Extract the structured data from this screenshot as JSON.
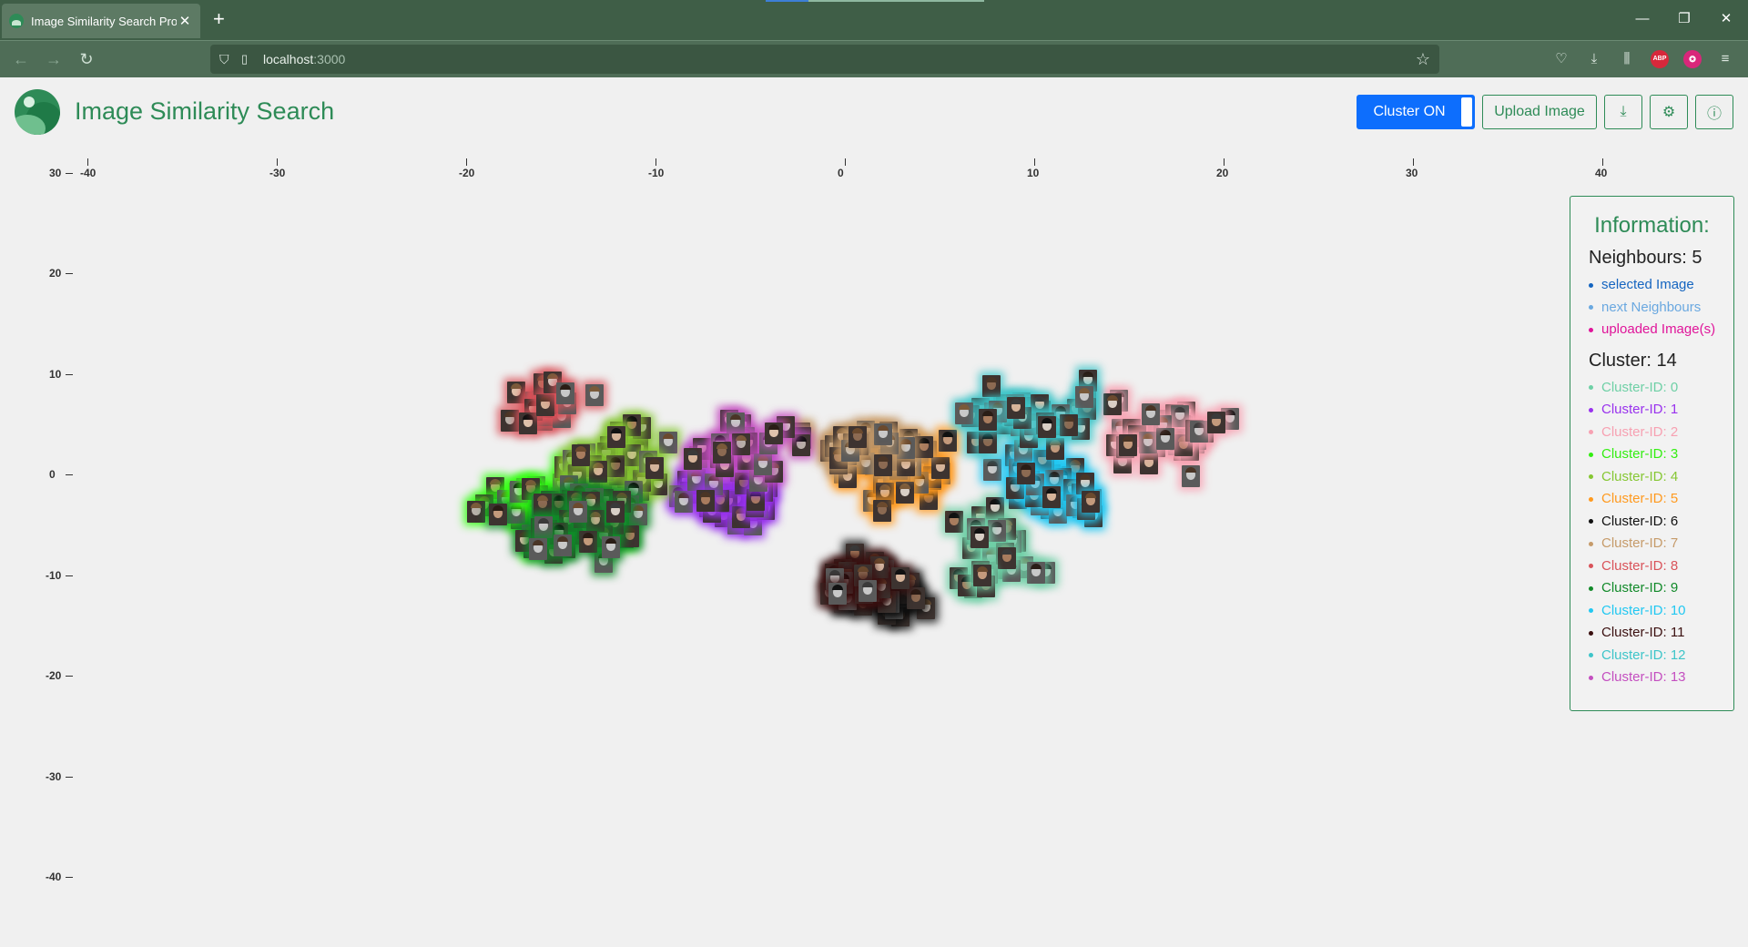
{
  "browser": {
    "tab_title": "Image Similarity Search Project",
    "url_host": "localhost",
    "url_port": ":3000"
  },
  "app": {
    "title": "Image Similarity Search",
    "cluster_toggle_label": "Cluster ON",
    "upload_label": "Upload Image"
  },
  "plot": {
    "x_ticks": [
      "-40",
      "-30",
      "-20",
      "-10",
      "0",
      "10",
      "20",
      "30",
      "40"
    ],
    "y_ticks": [
      "30",
      "20",
      "10",
      "0",
      "-10",
      "-20",
      "-30",
      "-40"
    ],
    "x_range": [
      -40,
      40
    ],
    "y_range": [
      -40,
      30
    ],
    "image_count": 460,
    "cluster_colors": [
      "#6fd0a6",
      "#9932ee",
      "#f7a1b2",
      "#33ff11",
      "#86c733",
      "#ff9a1f",
      "#111111",
      "#c69b6a",
      "#d9535a",
      "#128a2a",
      "#22c8f2",
      "#3b1010",
      "#3ec5c9",
      "#c44fc0"
    ],
    "clusters": [
      {
        "id": 0,
        "cx": 8,
        "cy": -7,
        "sx": 3,
        "sy": 5,
        "n": 30
      },
      {
        "id": 1,
        "cx": -6,
        "cy": -1,
        "sx": 3,
        "sy": 4,
        "n": 40
      },
      {
        "id": 2,
        "cx": 17,
        "cy": 4,
        "sx": 3,
        "sy": 4,
        "n": 40
      },
      {
        "id": 3,
        "cx": -16,
        "cy": -3,
        "sx": 4,
        "sy": 4,
        "n": 35
      },
      {
        "id": 4,
        "cx": -12,
        "cy": 1,
        "sx": 3,
        "sy": 4,
        "n": 40
      },
      {
        "id": 5,
        "cx": 3,
        "cy": 0,
        "sx": 3,
        "sy": 4,
        "n": 40
      },
      {
        "id": 6,
        "cx": 2,
        "cy": -12,
        "sx": 3,
        "sy": 3,
        "n": 30
      },
      {
        "id": 7,
        "cx": 1,
        "cy": 3,
        "sx": 3,
        "sy": 3,
        "n": 25
      },
      {
        "id": 8,
        "cx": -16,
        "cy": 7,
        "sx": 3,
        "sy": 3,
        "n": 20
      },
      {
        "id": 9,
        "cx": -14,
        "cy": -5,
        "sx": 4,
        "sy": 4,
        "n": 45
      },
      {
        "id": 10,
        "cx": 11,
        "cy": -1,
        "sx": 3,
        "sy": 5,
        "n": 40
      },
      {
        "id": 11,
        "cx": 1,
        "cy": -10,
        "sx": 3,
        "sy": 3,
        "n": 20
      },
      {
        "id": 12,
        "cx": 10,
        "cy": 6,
        "sx": 4,
        "sy": 3,
        "n": 35
      },
      {
        "id": 13,
        "cx": -5,
        "cy": 3,
        "sx": 3,
        "sy": 3,
        "n": 20
      }
    ]
  },
  "info": {
    "heading": "Information:",
    "neighbours": "Neighbours: 5",
    "legend": [
      {
        "label": "selected Image",
        "color": "#1565c0"
      },
      {
        "label": "next Neighbours",
        "color": "#6aa8e0"
      },
      {
        "label": "uploaded Image(s)",
        "color": "#e0159a"
      }
    ],
    "cluster_count": "Cluster: 14",
    "clusters": [
      {
        "label": "Cluster-ID: 0",
        "color": "#6fd0a6"
      },
      {
        "label": "Cluster-ID: 1",
        "color": "#9932ee"
      },
      {
        "label": "Cluster-ID: 2",
        "color": "#f7a1b2"
      },
      {
        "label": "Cluster-ID: 3",
        "color": "#33ee11"
      },
      {
        "label": "Cluster-ID: 4",
        "color": "#86c733"
      },
      {
        "label": "Cluster-ID: 5",
        "color": "#ff9a1f"
      },
      {
        "label": "Cluster-ID: 6",
        "color": "#111111"
      },
      {
        "label": "Cluster-ID: 7",
        "color": "#c69b6a"
      },
      {
        "label": "Cluster-ID: 8",
        "color": "#d9535a"
      },
      {
        "label": "Cluster-ID: 9",
        "color": "#128a2a"
      },
      {
        "label": "Cluster-ID: 10",
        "color": "#22c8f2"
      },
      {
        "label": "Cluster-ID: 11",
        "color": "#3b1010"
      },
      {
        "label": "Cluster-ID: 12",
        "color": "#3ec5c9"
      },
      {
        "label": "Cluster-ID: 13",
        "color": "#c44fc0"
      }
    ]
  }
}
